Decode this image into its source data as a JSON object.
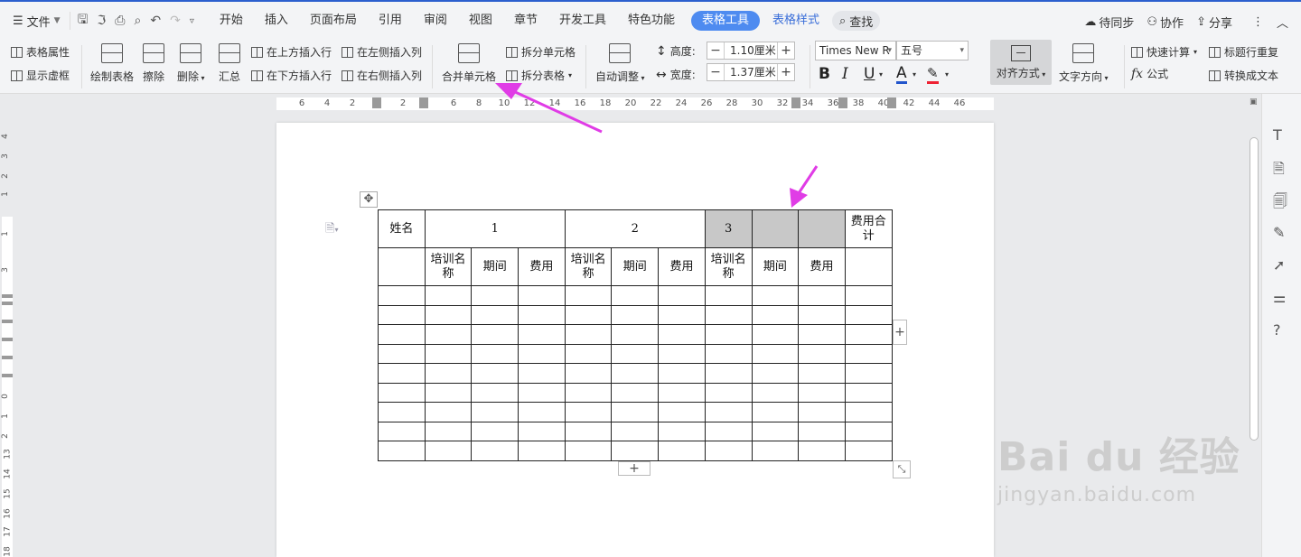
{
  "menubar": {
    "file_label": "文件",
    "tabs": [
      "开始",
      "插入",
      "页面布局",
      "引用",
      "审阅",
      "视图",
      "章节",
      "开发工具",
      "特色功能"
    ],
    "active_tab": "表格工具",
    "style_tab": "表格样式",
    "search": "查找",
    "sync": "待同步",
    "collab": "协作",
    "share": "分享"
  },
  "ribbon": {
    "table_props": "表格属性",
    "show_grid": "显示虚框",
    "draw_table": "绘制表格",
    "erase": "擦除",
    "delete": "删除",
    "summary": "汇总",
    "insert_above": "在上方插入行",
    "insert_below": "在下方插入行",
    "insert_left": "在左侧插入列",
    "insert_right": "在右侧插入列",
    "merge_cells": "合并单元格",
    "split_cells": "拆分单元格",
    "split_table": "拆分表格",
    "auto_fit": "自动调整",
    "height_label": "高度:",
    "height_value": "1.10厘米",
    "width_label": "宽度:",
    "width_value": "1.37厘米",
    "font_name": "Times New R",
    "font_size": "五号",
    "align": "对齐方式",
    "text_direction": "文字方向",
    "quick_calc": "快速计算",
    "formula": "公式",
    "repeat_header": "标题行重复",
    "to_text": "转换成文本"
  },
  "ruler": {
    "h_labels": [
      "6",
      "4",
      "2",
      "2",
      "6",
      "8",
      "10",
      "12",
      "14",
      "16",
      "18",
      "20",
      "22",
      "24",
      "26",
      "28",
      "30",
      "32",
      "34",
      "36",
      "38",
      "40",
      "42",
      "44",
      "46"
    ],
    "v_labels": [
      "4",
      "3",
      "2",
      "1",
      "1",
      "3",
      "0",
      "1",
      "2",
      "13",
      "14",
      "15",
      "16",
      "17",
      "18"
    ]
  },
  "table": {
    "header_row": [
      "姓名",
      "1",
      "2",
      "3",
      "",
      "",
      "费用合计"
    ],
    "sub_row": [
      "",
      "培训名称",
      "期间",
      "费用",
      "培训名称",
      "期间",
      "费用",
      "培训名称",
      "期间",
      "费用",
      ""
    ],
    "empty_rows": 9
  },
  "watermark": {
    "logo": "Bai du 经验",
    "url": "jingyan.baidu.com"
  },
  "colors": {
    "accent": "#4e8bf0",
    "annotation_arrow": "#e03ce6",
    "selected_cell": "#c8c8c8"
  }
}
